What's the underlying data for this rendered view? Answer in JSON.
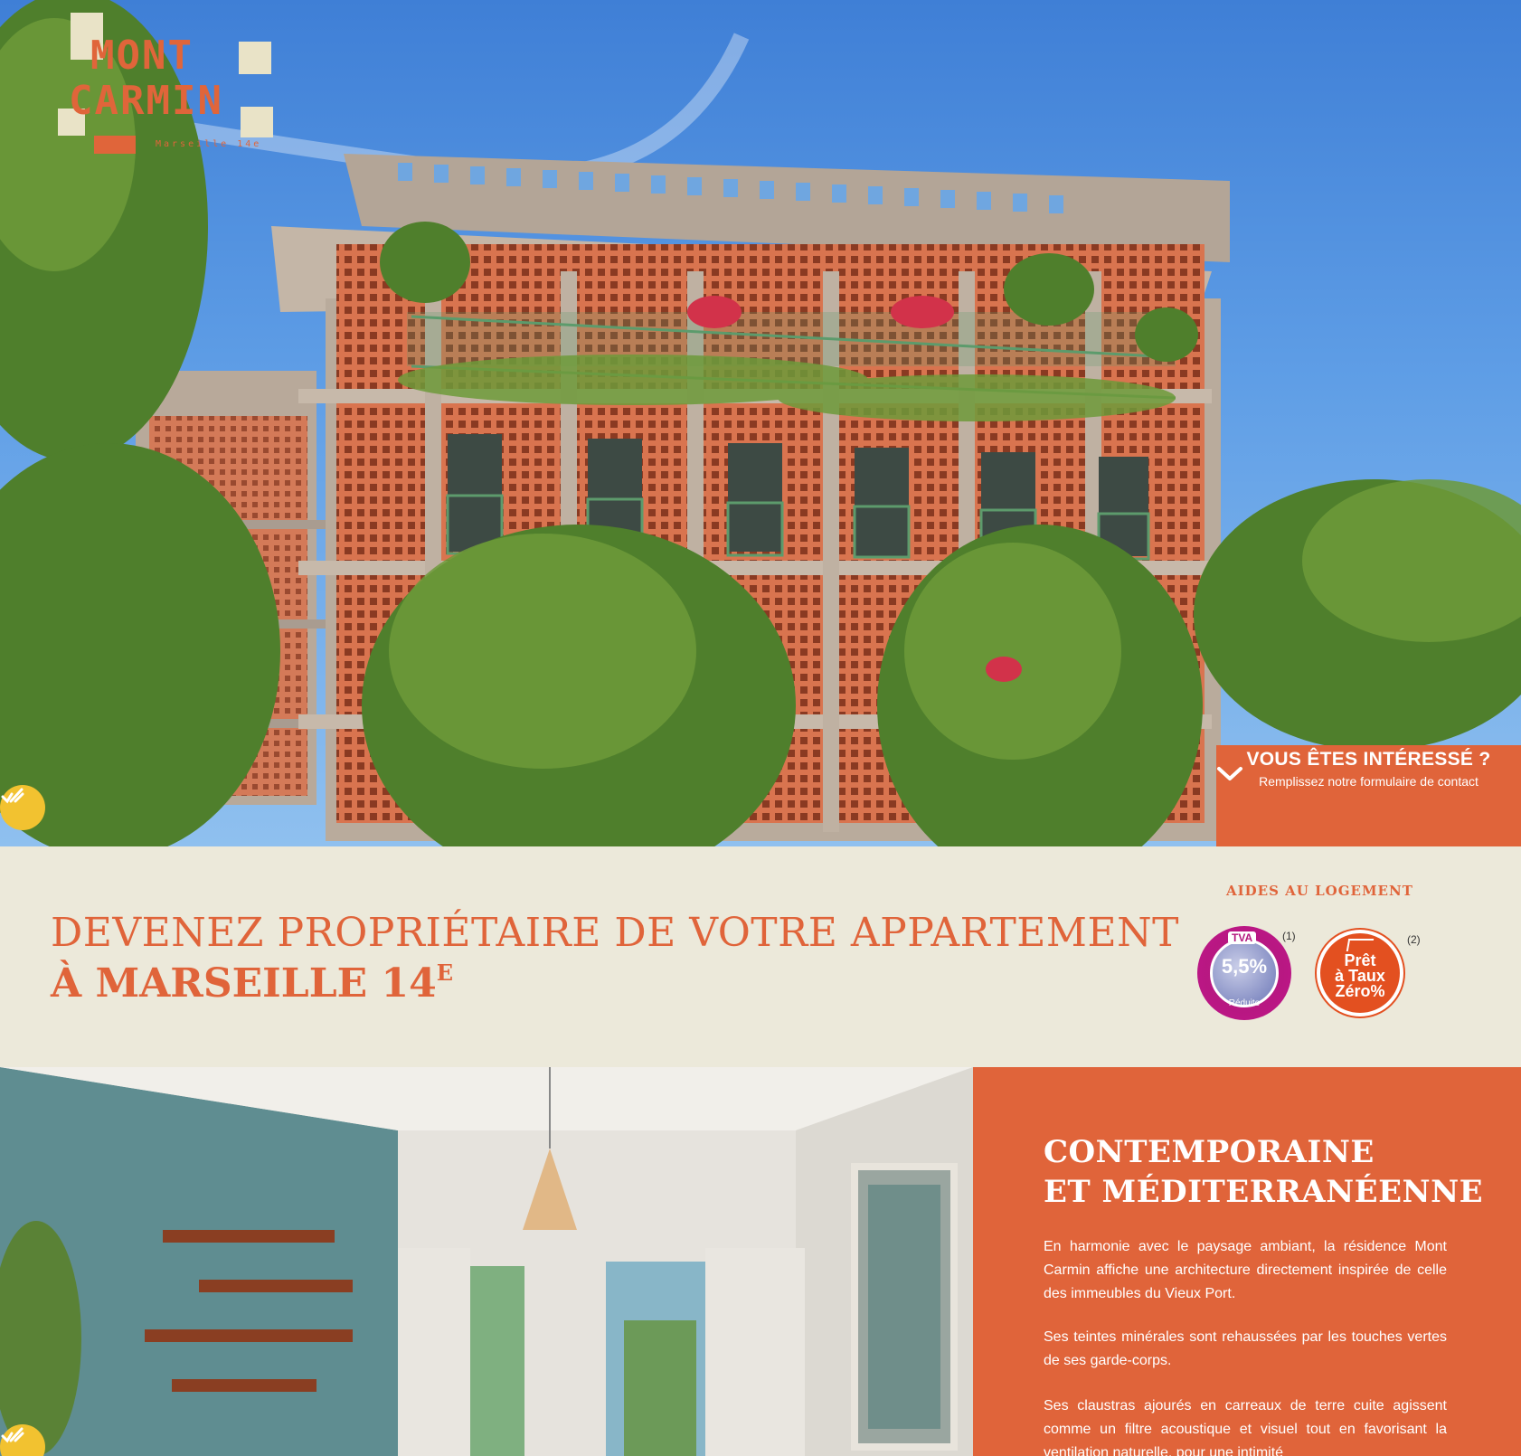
{
  "brand": {
    "logo_line1": "MONT",
    "logo_line2": "CARMIN",
    "logo_tagline": "Marseille 14e",
    "accent_color": "#e0643a",
    "cream_color": "#ece9da"
  },
  "cta": {
    "icon": "chevron-down-icon",
    "title": "VOUS ÊTES INTÉRESSÉ ?",
    "subtitle": "Remplissez notre formulaire de contact"
  },
  "accessibility": {
    "icon": "accessibility-icon",
    "color": "#f2c230"
  },
  "headline": {
    "line1": "DEVENEZ PROPRIÉTAIRE DE VOTRE APPARTEMENT",
    "line2": "À MARSEILLE 14",
    "line2_sup": "E"
  },
  "aides": {
    "title": "AIDES AU LOGEMENT",
    "tva": {
      "label": "TVA",
      "value": "5,5%",
      "sub": "Réduite",
      "note": "(1)"
    },
    "ptz": {
      "text": "Prêt\nà Taux\nZéro%",
      "note": "(2)"
    }
  },
  "section": {
    "title_line1": "CONTEMPORAINE",
    "title_line2": "ET MÉDITERRANÉENNE",
    "paragraphs": [
      "En harmonie avec le paysage ambiant, la résidence Mont Carmin affiche une architecture directement inspirée de celle des immeubles du Vieux Port.",
      "Ses teintes minérales sont rehaussées par les touches vertes de ses garde-corps.",
      "Ses claustras ajourés en carreaux de terre cuite agissent comme un filtre acoustique et visuel tout en favorisant la ventilation naturelle, pour une intimité"
    ]
  }
}
